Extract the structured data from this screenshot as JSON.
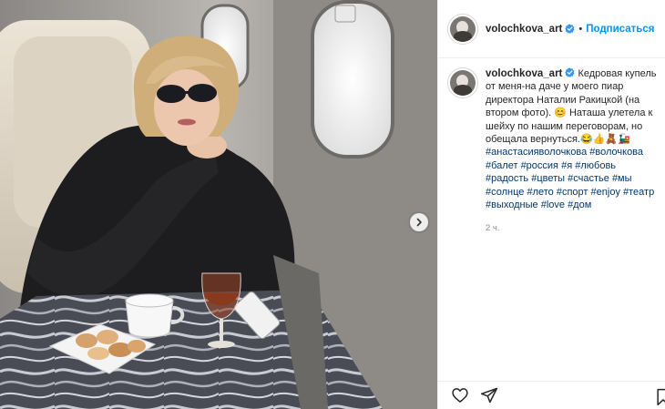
{
  "post": {
    "username": "volochkova_art",
    "separator": "•",
    "follow_label": "Подписаться",
    "caption": {
      "username": "volochkova_art",
      "lines": [
        "Кедровая купель",
        "от меня-на даче у моего пиар",
        "директора Наталии Ракицкой (на",
        "втором фото). 😊 Наташа улетела к",
        "шейху по нашим переговорам, но",
        "обещала вернуться.😂👍🧸🚂"
      ],
      "hashtags": [
        "#анастасияволочкова",
        "#волочкова",
        "#балет",
        "#россия",
        "#я",
        "#любовь",
        "#радость",
        "#цветы",
        "#счастье",
        "#мы",
        "#солнце",
        "#лето",
        "#спорт",
        "#enjoy",
        "#театр",
        "#выходные",
        "#love",
        "#дом"
      ],
      "timestamp": "2 ч."
    }
  },
  "colors": {
    "accent_blue": "#0095f6",
    "hashtag_blue": "#00376b",
    "verified_blue": "#3897f0",
    "muted_gray": "#8e8e8e"
  },
  "icons": {
    "verified": "verified-badge-icon",
    "next": "chevron-right-icon",
    "like": "heart-icon",
    "share": "paper-plane-icon",
    "save": "bookmark-icon"
  }
}
